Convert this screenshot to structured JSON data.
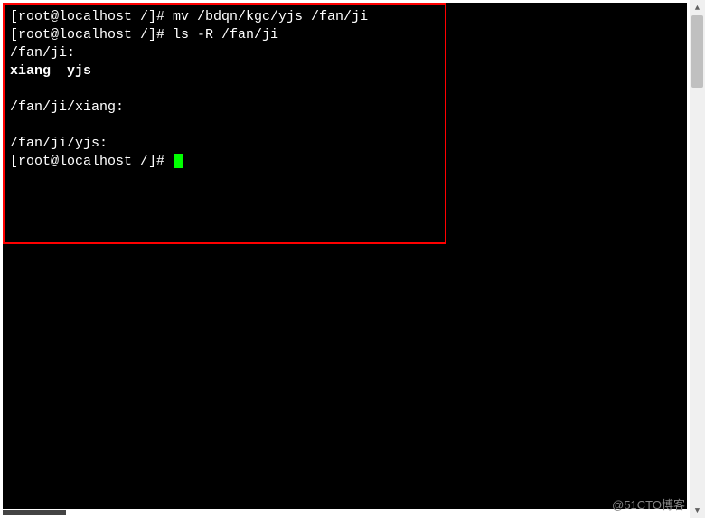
{
  "terminal": {
    "lines": [
      {
        "prompt": "[root@localhost /]# ",
        "command": "mv /bdqn/kgc/yjs /fan/ji",
        "bold": false
      },
      {
        "prompt": "[root@localhost /]# ",
        "command": "ls -R /fan/ji",
        "bold": false
      },
      {
        "text": "/fan/ji:",
        "bold": false
      },
      {
        "text": "xiang  yjs",
        "bold": true
      },
      {
        "text": "",
        "bold": false
      },
      {
        "text": "/fan/ji/xiang:",
        "bold": false
      },
      {
        "text": "",
        "bold": false
      },
      {
        "text": "/fan/ji/yjs:",
        "bold": false
      },
      {
        "prompt": "[root@localhost /]# ",
        "command": "",
        "cursor": true,
        "bold": false
      }
    ]
  },
  "watermark": "@51CTO博客",
  "scrollbar": {
    "up": "▲",
    "down": "▼"
  }
}
